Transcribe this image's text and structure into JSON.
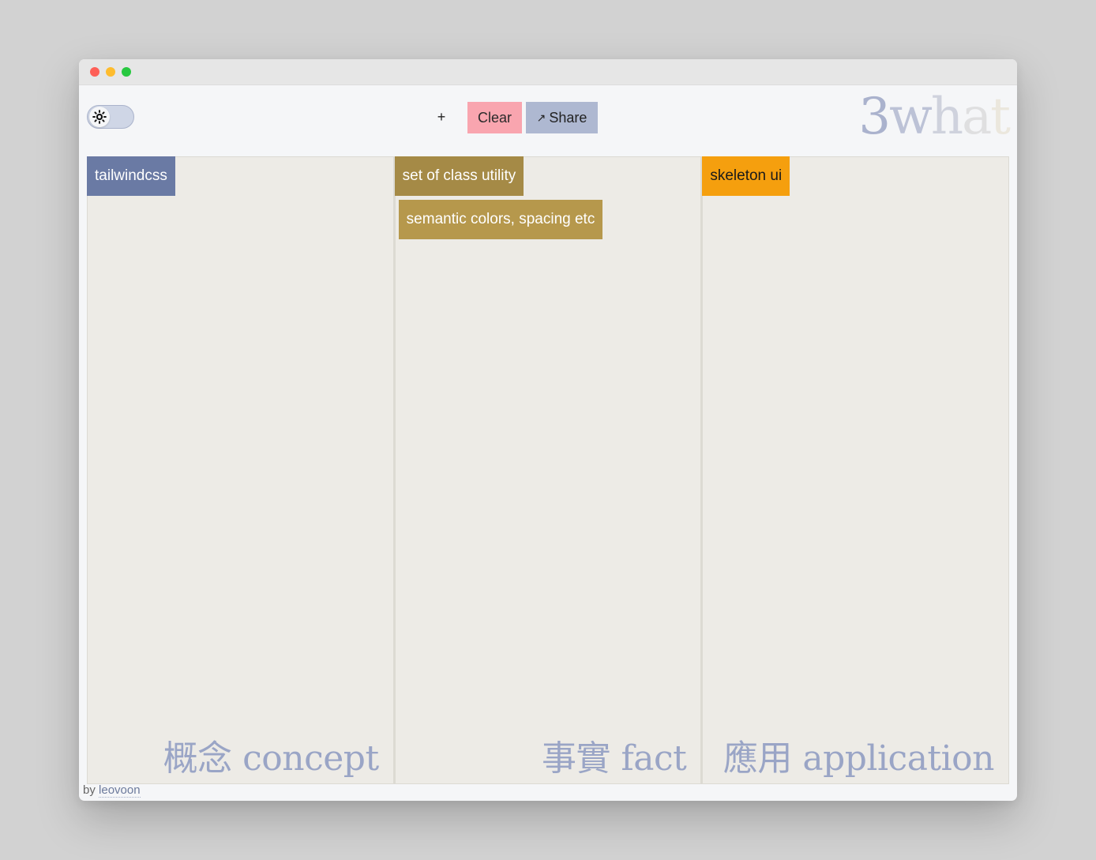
{
  "window": {
    "controls": [
      "close-icon",
      "minimize-icon",
      "maximize-icon"
    ]
  },
  "toolbar": {
    "theme_icon": "sun-icon",
    "add_label": "+",
    "clear_label": "Clear",
    "share_icon": "↗",
    "share_label": "Share"
  },
  "logo": {
    "letters": [
      "3",
      "w",
      "h",
      "a",
      "t"
    ],
    "colors": [
      "#aab2cd",
      "#bcc2d6",
      "#cfd2dd",
      "#dfdfe0",
      "#ebe7dd"
    ]
  },
  "columns": [
    {
      "label": "概念 concept",
      "cards": [
        {
          "text": "tailwindcss",
          "bg": "#6a7aa4",
          "fg": "#ffffff"
        }
      ]
    },
    {
      "label": "事實 fact",
      "cards": [
        {
          "text": "set of class utility",
          "bg": "#a58a46",
          "fg": "#ffffff"
        },
        {
          "text": "semantic colors, spacing etc",
          "bg": "#b6984c",
          "fg": "#ffffff"
        }
      ]
    },
    {
      "label": "應用 application",
      "cards": [
        {
          "text": "skeleton ui",
          "bg": "#f59f0e",
          "fg": "#1a1a1a"
        }
      ]
    }
  ],
  "footer": {
    "prefix": "by",
    "author": "leovoon"
  }
}
